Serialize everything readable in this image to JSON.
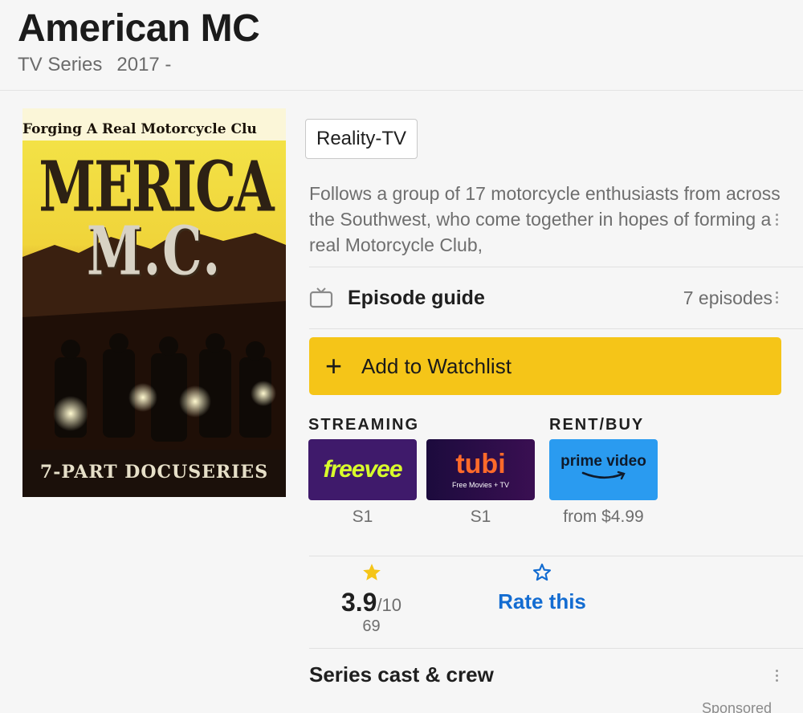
{
  "header": {
    "title": "American MC",
    "type": "TV Series",
    "years": "2017 -"
  },
  "poster": {
    "tagline": "Forging A Real Motorcycle Clu",
    "title_line1": "MERICA",
    "title_line2": "M.C.",
    "footer": "7-PART DOCUSERIES"
  },
  "genres": [
    "Reality-TV"
  ],
  "plot": "Follows a group of 17 motorcycle enthusiasts from across the Southwest, who come together in hopes of forming a real Motorcycle Club,",
  "episode_guide": {
    "label": "Episode guide",
    "count": "7 episodes",
    "icon": "tv-icon"
  },
  "watchlist": {
    "plus": "+",
    "label": "Add to Watchlist"
  },
  "streaming": {
    "heading": "STREAMING",
    "providers": [
      {
        "name": "freevee",
        "note": "S1"
      },
      {
        "name": "tubi",
        "sub": "Free Movies + TV",
        "note": "S1"
      }
    ]
  },
  "rent_buy": {
    "heading": "RENT/BUY",
    "providers": [
      {
        "name": "prime video",
        "note": "from $4.99"
      }
    ]
  },
  "rating": {
    "value": "3.9",
    "max": "/10",
    "count": "69"
  },
  "rate_this": {
    "label": "Rate this"
  },
  "cast": {
    "label": "Series cast & crew"
  },
  "sponsored": "Sponsored",
  "colors": {
    "accent_yellow": "#f5c518",
    "link_blue": "#136cd1",
    "freevee_bg": "#3f1a6b",
    "tubi_bg": "#2a0d48",
    "prime_bg": "#2a9bf0"
  }
}
